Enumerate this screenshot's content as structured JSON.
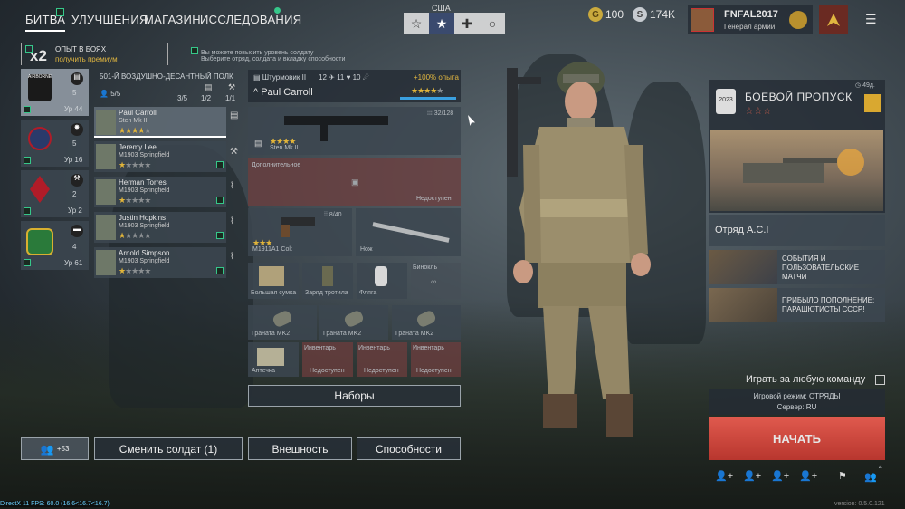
{
  "nav": {
    "items": [
      {
        "label": "БИТВА",
        "active": true
      },
      {
        "label": "УЛУЧШЕНИЯ"
      },
      {
        "label": "МАГАЗИН"
      },
      {
        "label": "ИССЛЕДОВАНИЯ"
      }
    ]
  },
  "faction": {
    "label": "США",
    "icons": [
      "star-icon",
      "usa-star-icon",
      "cross-icon",
      "circle-icon"
    ],
    "selected": 1
  },
  "currency": {
    "gold": "100",
    "silver": "174K"
  },
  "player": {
    "name": "FNFAL2017",
    "rank": "Генерал армии"
  },
  "xp_boost": {
    "multiplier": "x2",
    "title": "ОПЫТ В БОЯХ",
    "link": "получить премиум"
  },
  "hints": [
    "Вы можете повысить уровень солдату",
    "Выберите отряд, солдата и вкладку способности"
  ],
  "squads": [
    {
      "patch": "AIRBORNE",
      "count": "5",
      "level": "Ур 44",
      "color": "#1a1a1a"
    },
    {
      "patch": "",
      "count": "5",
      "level": "Ур 16",
      "color": "#2a3a6a"
    },
    {
      "patch": "",
      "count": "2",
      "level": "Ур 2",
      "color": "#b01c28"
    },
    {
      "patch": "",
      "count": "4",
      "level": "Ур 61",
      "color": "#2a7a3a"
    }
  ],
  "regiment": {
    "name": "501-Й ВОЗДУШНО-ДЕСАНТНЫЙ ПОЛК",
    "members": "5/5",
    "slot1": "3/5",
    "slot2": "1/2",
    "slot3": "1/1"
  },
  "soldiers": [
    {
      "name": "Paul Carroll",
      "weapon": "Sten Mk II",
      "stars": 4
    },
    {
      "name": "Jeremy Lee",
      "weapon": "M1903 Springfield",
      "stars": 1
    },
    {
      "name": "Herman Torres",
      "weapon": "M1903 Springfield",
      "stars": 1
    },
    {
      "name": "Justin Hopkins",
      "weapon": "M1903 Springfield",
      "stars": 1
    },
    {
      "name": "Arnold Simpson",
      "weapon": "M1903 Springfield",
      "stars": 1
    }
  ],
  "soldier_detail": {
    "class": "Штурмовик II",
    "stat1": "12",
    "stat2": "11",
    "stat3": "10",
    "xp_bonus": "+100% опыта",
    "name": "Paul Carroll",
    "primary": {
      "name": "Sten Mk II",
      "ammo": "32/128"
    },
    "secondary_label": "Дополнительное",
    "unavailable": "Недоступен",
    "pistol": {
      "name": "M1911A1 Colt",
      "ammo": "8/40"
    },
    "melee": {
      "name": "Нож"
    },
    "items": [
      "Большая сумка",
      "Заряд тротила",
      "Фляга",
      "Бинокль"
    ],
    "grenades": [
      "Граната MK2",
      "Граната MK2",
      "Граната MK2"
    ],
    "kit": "Аптечка",
    "inventory": "Инвентарь",
    "sets": "Наборы"
  },
  "bottom": {
    "squad_count": "+53",
    "change_soldier": "Сменить солдат (1)",
    "appearance": "Внешность",
    "abilities": "Способности"
  },
  "battlepass": {
    "title": "БОЕВОЙ ПРОПУСК",
    "time": "49д.",
    "year": "2023"
  },
  "squad_card": {
    "name": "Отряд A.C.I"
  },
  "events": [
    {
      "text": "СОБЫТИЯ И ПОЛЬЗОВАТЕЛЬСКИЕ МАТЧИ"
    },
    {
      "text": "ПРИБЫЛО ПОПОЛНЕНИЕ: ПАРАШЮТИСТЫ СССР!"
    }
  ],
  "play": {
    "any_team": "Играть за любую команду",
    "mode": "Игровой режим: ОТРЯДЫ",
    "server": "Сервер: RU",
    "start": "НАЧАТЬ",
    "party_count": "4"
  },
  "footer": {
    "fps": "DirectX 11 FPS: 60.0 (16.6<16.7<16.7)",
    "version": "version: 0.5.0.121"
  }
}
